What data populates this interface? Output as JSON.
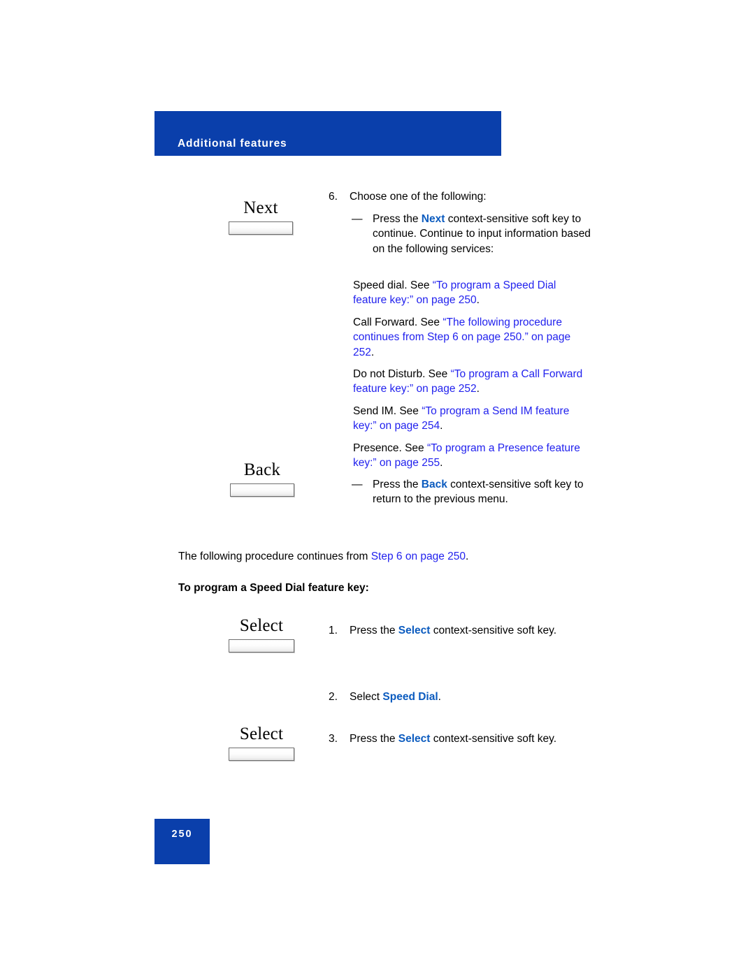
{
  "header": {
    "title": "Additional features"
  },
  "softkeys": [
    {
      "label": "Next",
      "name": "next"
    },
    {
      "label": "Back",
      "name": "back"
    },
    {
      "label": "Select",
      "name": "select-1"
    },
    {
      "label": "Select",
      "name": "select-2"
    }
  ],
  "step6": {
    "number": "6.",
    "text": "Choose one of the following:"
  },
  "dash_next": {
    "mark": "—",
    "lead": "Press the ",
    "keyword": "Next",
    "rest": " context-sensitive soft key to continue. Continue to input information based on the following services:"
  },
  "references": [
    {
      "lead": "Speed dial. See ",
      "link": "“To program a Speed Dial feature key:” on page 250",
      "tail": "."
    },
    {
      "lead": "Call Forward. See ",
      "link": "“The following procedure continues from  Step 6 on page 250.” on page 252",
      "tail": "."
    },
    {
      "lead": "Do not Disturb. See ",
      "link": "“To program a Call Forward feature key:” on page 252",
      "tail": "."
    },
    {
      "lead": "Send IM. See ",
      "link": "“To program a Send IM feature key:” on page 254",
      "tail": "."
    },
    {
      "lead": "Presence. See ",
      "link": "“To program a Presence feature key:” on page 255",
      "tail": "."
    }
  ],
  "dash_back": {
    "mark": "—",
    "lead": "Press the ",
    "keyword": "Back",
    "rest": " context-sensitive soft key to return to the previous menu."
  },
  "continue_para": {
    "lead": "The following procedure continues from  ",
    "link": "Step 6 on page 250",
    "tail": "."
  },
  "section_heading": "To program a Speed Dial feature key:",
  "steps": [
    {
      "number": "1.",
      "lead": "Press the ",
      "keyword": "Select",
      "rest": " context-sensitive soft key."
    },
    {
      "number": "2.",
      "lead": "Select ",
      "keyword": "Speed Dial",
      "rest": "."
    },
    {
      "number": "3.",
      "lead": "Press the ",
      "keyword": "Select",
      "rest": " context-sensitive soft key."
    }
  ],
  "footer": {
    "page_number": "250"
  },
  "colors": {
    "brand_blue": "#0a3fab",
    "link_blue": "#2222ee",
    "keyword_blue": "#0b5bbf"
  }
}
